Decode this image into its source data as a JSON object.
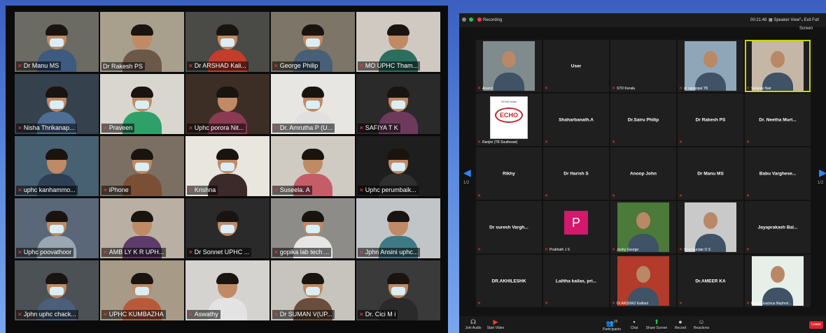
{
  "left_grid": {
    "tiles": [
      {
        "label": "Dr Manu MS",
        "muted": true
      },
      {
        "label": "Dr Rakesh PS",
        "muted": false,
        "active": true
      },
      {
        "label": "Dr ARSHAD Kali...",
        "muted": true
      },
      {
        "label": "George Philip",
        "muted": true
      },
      {
        "label": "MO UPHC Tham...",
        "muted": true
      },
      {
        "label": "Nisha Thrikanap...",
        "muted": true
      },
      {
        "label": "Praveen",
        "muted": true
      },
      {
        "label": "Uphc porora Nit...",
        "muted": true
      },
      {
        "label": "Dr. Amrutha P (U...",
        "muted": true
      },
      {
        "label": "SAFIYA T K",
        "muted": true
      },
      {
        "label": "uphc kanhammo...",
        "muted": true
      },
      {
        "label": "iPhone",
        "muted": true
      },
      {
        "label": "Krishna",
        "muted": true
      },
      {
        "label": "Suseela. A",
        "muted": true
      },
      {
        "label": "Uphc perumbaik...",
        "muted": true
      },
      {
        "label": "Uphc poovathoor",
        "muted": true
      },
      {
        "label": "AMB LY K R UPH...",
        "muted": true
      },
      {
        "label": "Dr Sonnet UPHC ...",
        "muted": true
      },
      {
        "label": "gopika lab tech ...",
        "muted": true
      },
      {
        "label": "Jphn Ansini uphc...",
        "muted": true
      },
      {
        "label": "Jphn uphc chack...",
        "muted": true
      },
      {
        "label": "UPHC KUMBAZHA",
        "muted": true
      },
      {
        "label": "Aswathy",
        "muted": true
      },
      {
        "label": "Dr SUMAN V(UP...",
        "muted": true
      },
      {
        "label": "Dr. Cici M i",
        "muted": true
      }
    ]
  },
  "zoom": {
    "topbar": {
      "recording_label": "Recording",
      "time": "00:21:48",
      "speaker_view_label": "Speaker View",
      "exit_full_screen_label": "Exit Full Screen"
    },
    "tiles": [
      {
        "name": "",
        "label": "Anand",
        "video": true
      },
      {
        "name": "User",
        "label": "",
        "video": false
      },
      {
        "name": "",
        "label": "STD Kerala",
        "video": false
      },
      {
        "name": "",
        "label": "dr rajagopal TB",
        "video": true
      },
      {
        "name": "",
        "label": "Sanjeev Nair",
        "video": true,
        "active": true
      },
      {
        "name": "",
        "label": "Ranjini (TB Southeast)",
        "video": false,
        "echo": true,
        "echo_top": "ECHO India",
        "echo_text": "ECHO"
      },
      {
        "name": "Shaharbanath.A",
        "label": "",
        "video": false
      },
      {
        "name": "Dr.Sairu Philip",
        "label": "",
        "video": false
      },
      {
        "name": "Dr Rakesh PS",
        "label": "",
        "video": false
      },
      {
        "name": "Dr. Neetha Murt...",
        "label": "",
        "video": false
      },
      {
        "name": "Rikhy",
        "label": "",
        "video": false
      },
      {
        "name": "Dr Harish S",
        "label": "",
        "video": false
      },
      {
        "name": "Anoop John",
        "label": "",
        "video": false
      },
      {
        "name": "Dr Manu MS",
        "label": "",
        "video": false
      },
      {
        "name": "Babu Varghese...",
        "label": "",
        "video": false
      },
      {
        "name": "Dr suresh Vargh...",
        "label": "",
        "video": false
      },
      {
        "name": "",
        "label": "Prabhath J S",
        "video": false,
        "avatar_letter": "P"
      },
      {
        "name": "",
        "label": "Joshy George",
        "video": true
      },
      {
        "name": "",
        "label": "Syamsundar O S",
        "video": true
      },
      {
        "name": "Jayaprakash Bal...",
        "label": "",
        "video": false
      },
      {
        "name": "DR.AKHILESHK",
        "label": "",
        "video": false
      },
      {
        "name": "Lalitha kailas, pri...",
        "label": "",
        "video": false
      },
      {
        "name": "",
        "label": "Dr ARSHAD Kalliant",
        "video": true
      },
      {
        "name": "Dr.AMEER KA",
        "label": "",
        "video": false
      },
      {
        "name": "",
        "label": "Noble Gracious Nephrol...",
        "video": true
      }
    ],
    "page_left": "1/2",
    "page_right": "1/2",
    "toolbar": {
      "join_audio": "Join Audio",
      "start_video": "Start Video",
      "participants": "Participants",
      "participants_count": "25",
      "chat": "Chat",
      "share_screen": "Share Screen",
      "record": "Record",
      "reactions": "Reactions",
      "leave": "Leave"
    }
  },
  "colors": {
    "active_border": "#c8d400",
    "muted_icon": "#ff3b3b",
    "zoom_blue": "#2b86ff",
    "share_green": "#23c552",
    "leave_red": "#d9262b",
    "avatar_pink": "#d4186c"
  }
}
